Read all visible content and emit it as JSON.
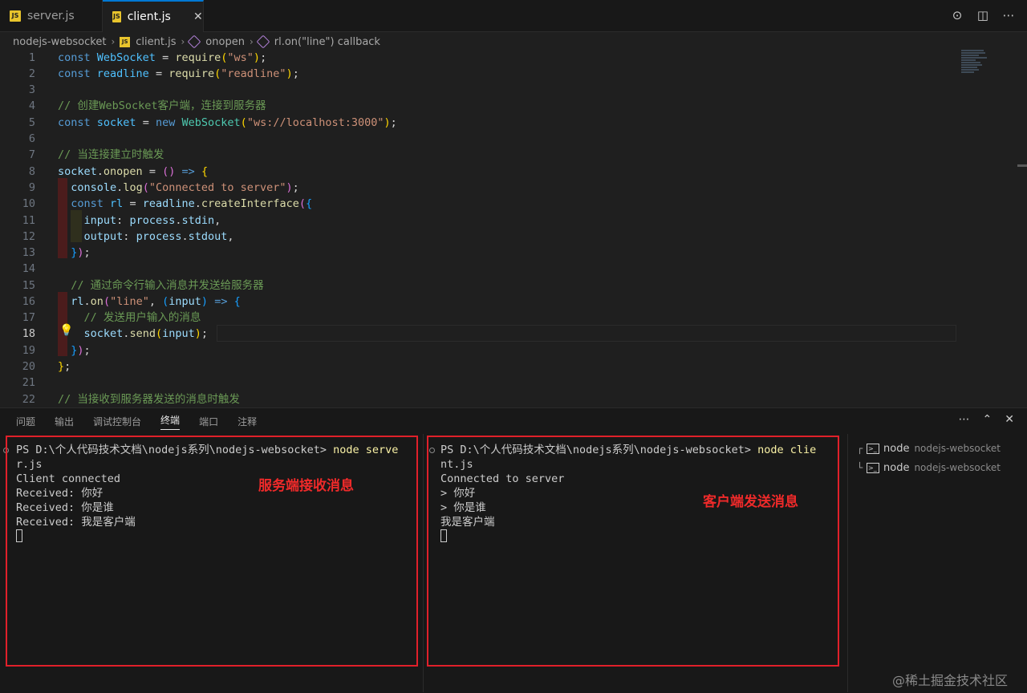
{
  "tabs": [
    {
      "label": "server.js",
      "icon": "js-file-icon",
      "active": false
    },
    {
      "label": "client.js",
      "icon": "js-file-icon",
      "active": true,
      "close": "✕"
    }
  ],
  "breadcrumb": {
    "folder": "nodejs-websocket",
    "file": "client.js",
    "symbol1": "onopen",
    "symbol2": "rl.on(\"line\") callback"
  },
  "editor": {
    "current_line": 18,
    "line_numbers": [
      "1",
      "2",
      "3",
      "4",
      "5",
      "6",
      "7",
      "8",
      "9",
      "10",
      "11",
      "12",
      "13",
      "14",
      "15",
      "16",
      "17",
      "18",
      "19",
      "20",
      "21",
      "22"
    ],
    "code": [
      "const WebSocket = require(\"ws\");",
      "const readline = require(\"readline\");",
      "",
      "// 创建WebSocket客户端，连接到服务器",
      "const socket = new WebSocket(\"ws://localhost:3000\");",
      "",
      "// 当连接建立时触发",
      "socket.onopen = () => {",
      "  console.log(\"Connected to server\");",
      "  const rl = readline.createInterface({",
      "    input: process.stdin,",
      "    output: process.stdout,",
      "  });",
      "",
      "  // 通过命令行输入消息并发送给服务器",
      "  rl.on(\"line\", (input) => {",
      "    // 发送用户输入的消息",
      "    socket.send(input);",
      "  });",
      "};",
      "",
      "// 当接收到服务器发送的消息时触发"
    ]
  },
  "panel": {
    "tabs": [
      "问题",
      "输出",
      "调试控制台",
      "终端",
      "端口",
      "注释"
    ],
    "active_tab": "终端"
  },
  "terminal_left": {
    "prompt": "PS D:\\个人代码技术文档\\nodejs系列\\nodejs-websocket> ",
    "command": "node serve",
    "command_wrap": "r.js",
    "lines": [
      "Client connected",
      "Received: 你好",
      "Received: 你是谁",
      "Received: 我是客户端"
    ],
    "annotation": "服务端接收消息"
  },
  "terminal_right": {
    "prompt": "PS D:\\个人代码技术文档\\nodejs系列\\nodejs-websocket> ",
    "command": "node clie",
    "command_wrap": "nt.js",
    "lines": [
      "Connected to server",
      "> 你好",
      "> 你是谁",
      "我是客户端"
    ],
    "annotation": "客户端发送消息"
  },
  "terminal_list": [
    {
      "name": "node",
      "folder": "nodejs-websocket"
    },
    {
      "name": "node",
      "folder": "nodejs-websocket"
    }
  ],
  "watermark": "@稀土掘金技术社区",
  "colors": {
    "annotation": "#e0202a",
    "accent": "#0078d4"
  }
}
